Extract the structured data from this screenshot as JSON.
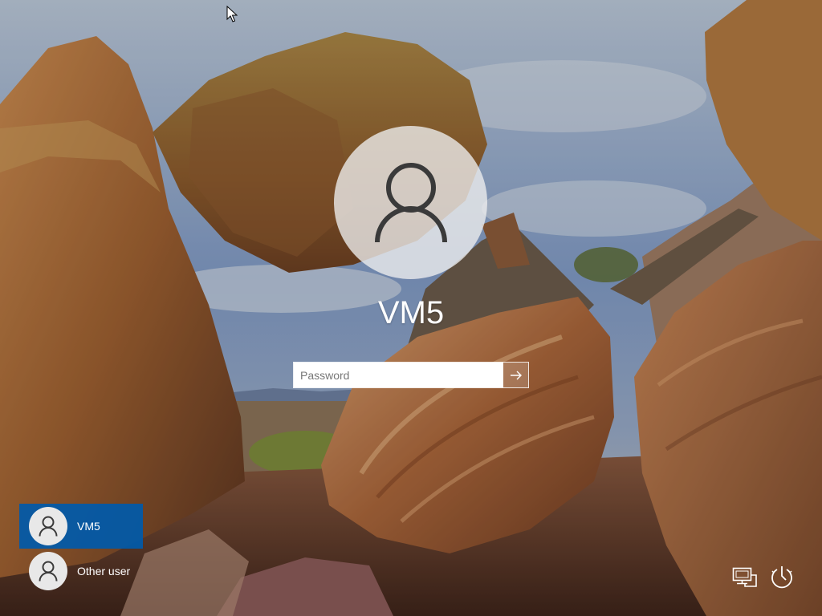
{
  "login": {
    "username": "VM5",
    "password_placeholder": "Password",
    "submit_icon": "arrow-right-icon",
    "avatar_icon": "user-icon"
  },
  "users": [
    {
      "name": "VM5",
      "selected": true,
      "icon": "user-icon"
    },
    {
      "name": "Other user",
      "selected": false,
      "icon": "user-icon"
    }
  ],
  "system_buttons": {
    "network_icon": "network-icon",
    "power_icon": "power-icon"
  },
  "colors": {
    "selected_user_bg": "#005aaa",
    "text": "#ffffff",
    "avatar_bg": "#eeeeee",
    "avatar_glyph": "#3a3a3a"
  }
}
